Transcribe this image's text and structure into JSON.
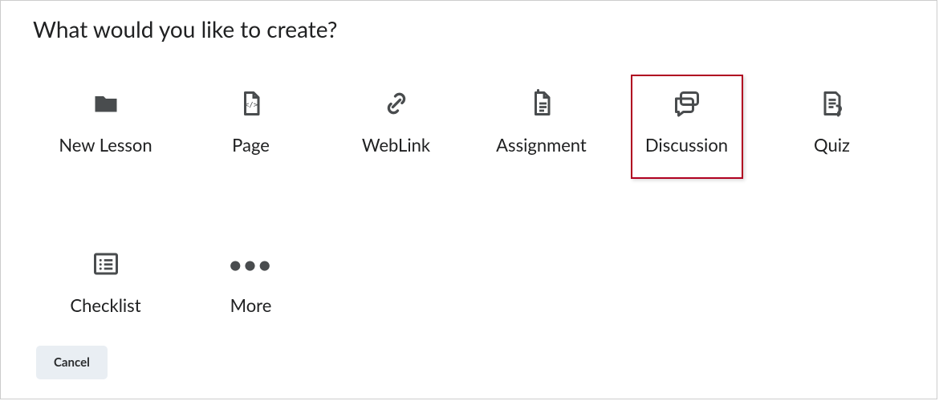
{
  "title": "What would you like to create?",
  "tiles": [
    {
      "label": "New Lesson",
      "icon": "folder-icon",
      "highlighted": false
    },
    {
      "label": "Page",
      "icon": "page-icon",
      "highlighted": false
    },
    {
      "label": "WebLink",
      "icon": "link-icon",
      "highlighted": false
    },
    {
      "label": "Assignment",
      "icon": "assignment-icon",
      "highlighted": false
    },
    {
      "label": "Discussion",
      "icon": "discussion-icon",
      "highlighted": true
    },
    {
      "label": "Quiz",
      "icon": "quiz-icon",
      "highlighted": false
    },
    {
      "label": "Checklist",
      "icon": "checklist-icon",
      "highlighted": false
    },
    {
      "label": "More",
      "icon": "more-icon",
      "highlighted": false
    }
  ],
  "footer": {
    "cancel_label": "Cancel"
  }
}
